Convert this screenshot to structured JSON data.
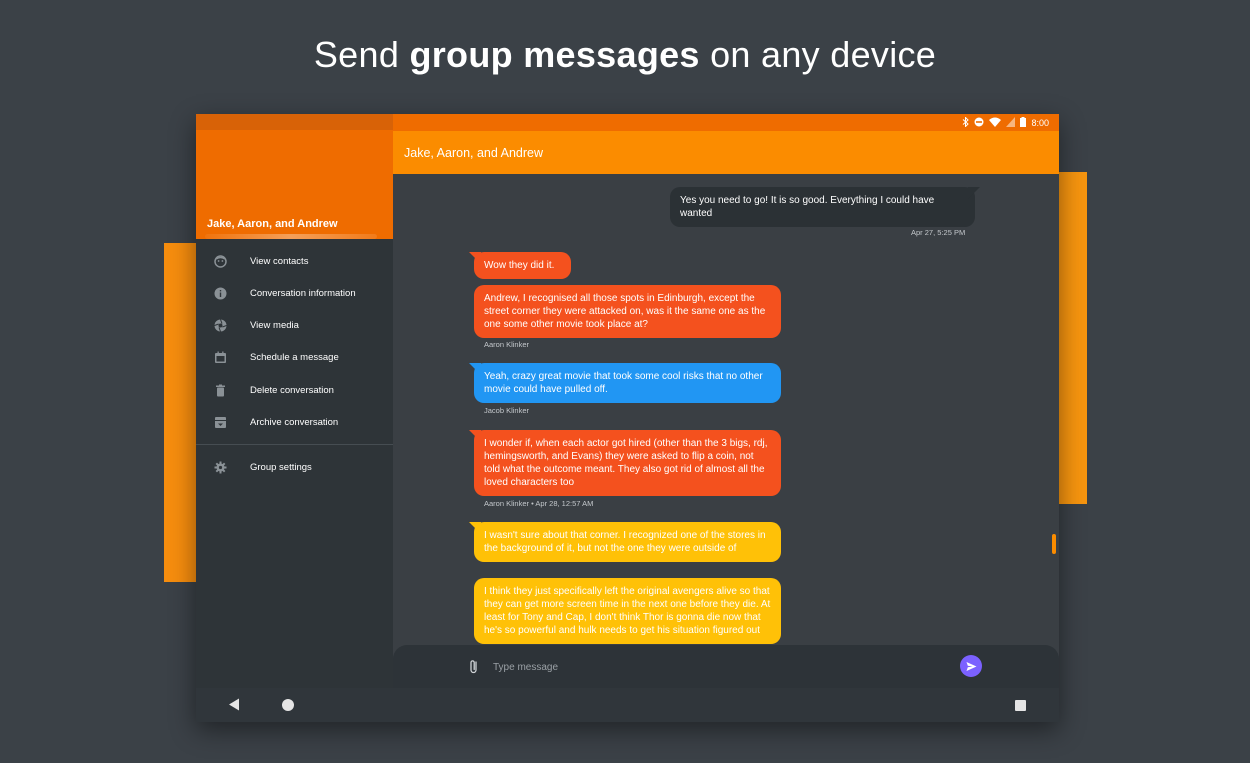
{
  "headline": {
    "prefix": "Send ",
    "bold": "group messages",
    "suffix": " on any device"
  },
  "status_bar": {
    "time": "8:00"
  },
  "drawer": {
    "title": "Jake, Aaron, and Andrew",
    "items": [
      {
        "label": "View contacts",
        "icon": "face-icon"
      },
      {
        "label": "Conversation information",
        "icon": "info-icon"
      },
      {
        "label": "View media",
        "icon": "aperture-icon"
      },
      {
        "label": "Schedule a message",
        "icon": "calendar-icon"
      },
      {
        "label": "Delete conversation",
        "icon": "trash-icon"
      },
      {
        "label": "Archive conversation",
        "icon": "archive-icon"
      }
    ],
    "settings": {
      "label": "Group settings",
      "icon": "gear-icon"
    }
  },
  "toolbar": {
    "title": "Jake, Aaron, and Andrew"
  },
  "messages": [
    {
      "text": "Yes you need to go! It is so good. Everything I could have wanted",
      "meta": "Apr 27, 5:25 PM",
      "color": "#2b3135"
    },
    {
      "text": "Wow they did it.",
      "meta": "",
      "color": "#f4511e"
    },
    {
      "text": "Andrew, I recognised all those spots in Edinburgh, except the street corner they were attacked on, was it the same one as the one some other movie took place at?",
      "meta": "Aaron Klinker",
      "color": "#f4511e"
    },
    {
      "text": "Yeah, crazy great movie that took some cool risks that no other movie could have pulled off.",
      "meta": "Jacob Klinker",
      "color": "#2196f3"
    },
    {
      "text": "I wonder if, when each actor got hired (other than the 3 bigs, rdj, hemingsworth, and Evans) they were asked to flip a coin, not told what the outcome meant. They also got rid of almost all the loved characters too",
      "meta": "Aaron Klinker • Apr 28, 12:57 AM",
      "color": "#f4511e"
    },
    {
      "text": "I wasn't sure about that corner. I recognized one of the stores in the background of it, but not the one they were outside of",
      "meta": "",
      "color": "#ffc107"
    },
    {
      "text": "I think they just specifically left the original avengers alive so that they can get more screen time in the next one before they die. At least for Tony and Cap, I don't think Thor is gonna die now that he's so powerful and hulk needs to get his situation figured out",
      "meta": "",
      "color": "#ffc107"
    }
  ],
  "input": {
    "placeholder": "Type message"
  },
  "colors": {
    "accent": "#ef6c00",
    "toolbar": "#fb8c00",
    "send": "#7b61ff"
  }
}
